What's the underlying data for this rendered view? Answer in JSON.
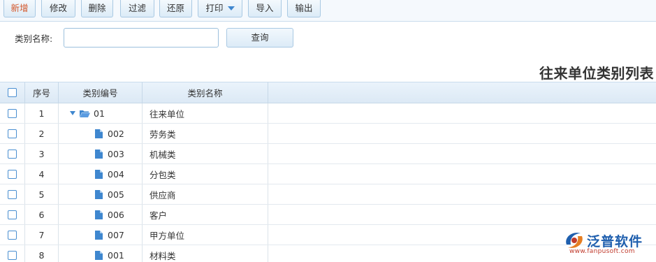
{
  "toolbar": {
    "buttons": [
      {
        "label": "新增"
      },
      {
        "label": "修改"
      },
      {
        "label": "删除"
      },
      {
        "label": "过滤"
      },
      {
        "label": "还原"
      },
      {
        "label": "打印"
      },
      {
        "label": "导入"
      },
      {
        "label": "输出"
      }
    ]
  },
  "search": {
    "label": "类别名称:",
    "value": "",
    "button_label": "查询"
  },
  "page_title": "往来单位类别列表",
  "table": {
    "columns": [
      "序号",
      "类别编号",
      "类别名称"
    ],
    "rows": [
      {
        "seq": "1",
        "code": "01",
        "name": "往来单位"
      },
      {
        "seq": "2",
        "code": "002",
        "name": "劳务类"
      },
      {
        "seq": "3",
        "code": "003",
        "name": "机械类"
      },
      {
        "seq": "4",
        "code": "004",
        "name": "分包类"
      },
      {
        "seq": "5",
        "code": "005",
        "name": "供应商"
      },
      {
        "seq": "6",
        "code": "006",
        "name": "客户"
      },
      {
        "seq": "7",
        "code": "007",
        "name": "甲方单位"
      },
      {
        "seq": "8",
        "code": "001",
        "name": "材料类"
      }
    ]
  },
  "watermark": {
    "name": "泛普软件",
    "url": "www.fanpusoft.com"
  },
  "colors": {
    "accent": "#3f87cf",
    "new_button_text": "#d4572a",
    "header_bg": "#dce9f5",
    "logo_blue": "#1f5fae",
    "logo_red": "#c0392b"
  }
}
